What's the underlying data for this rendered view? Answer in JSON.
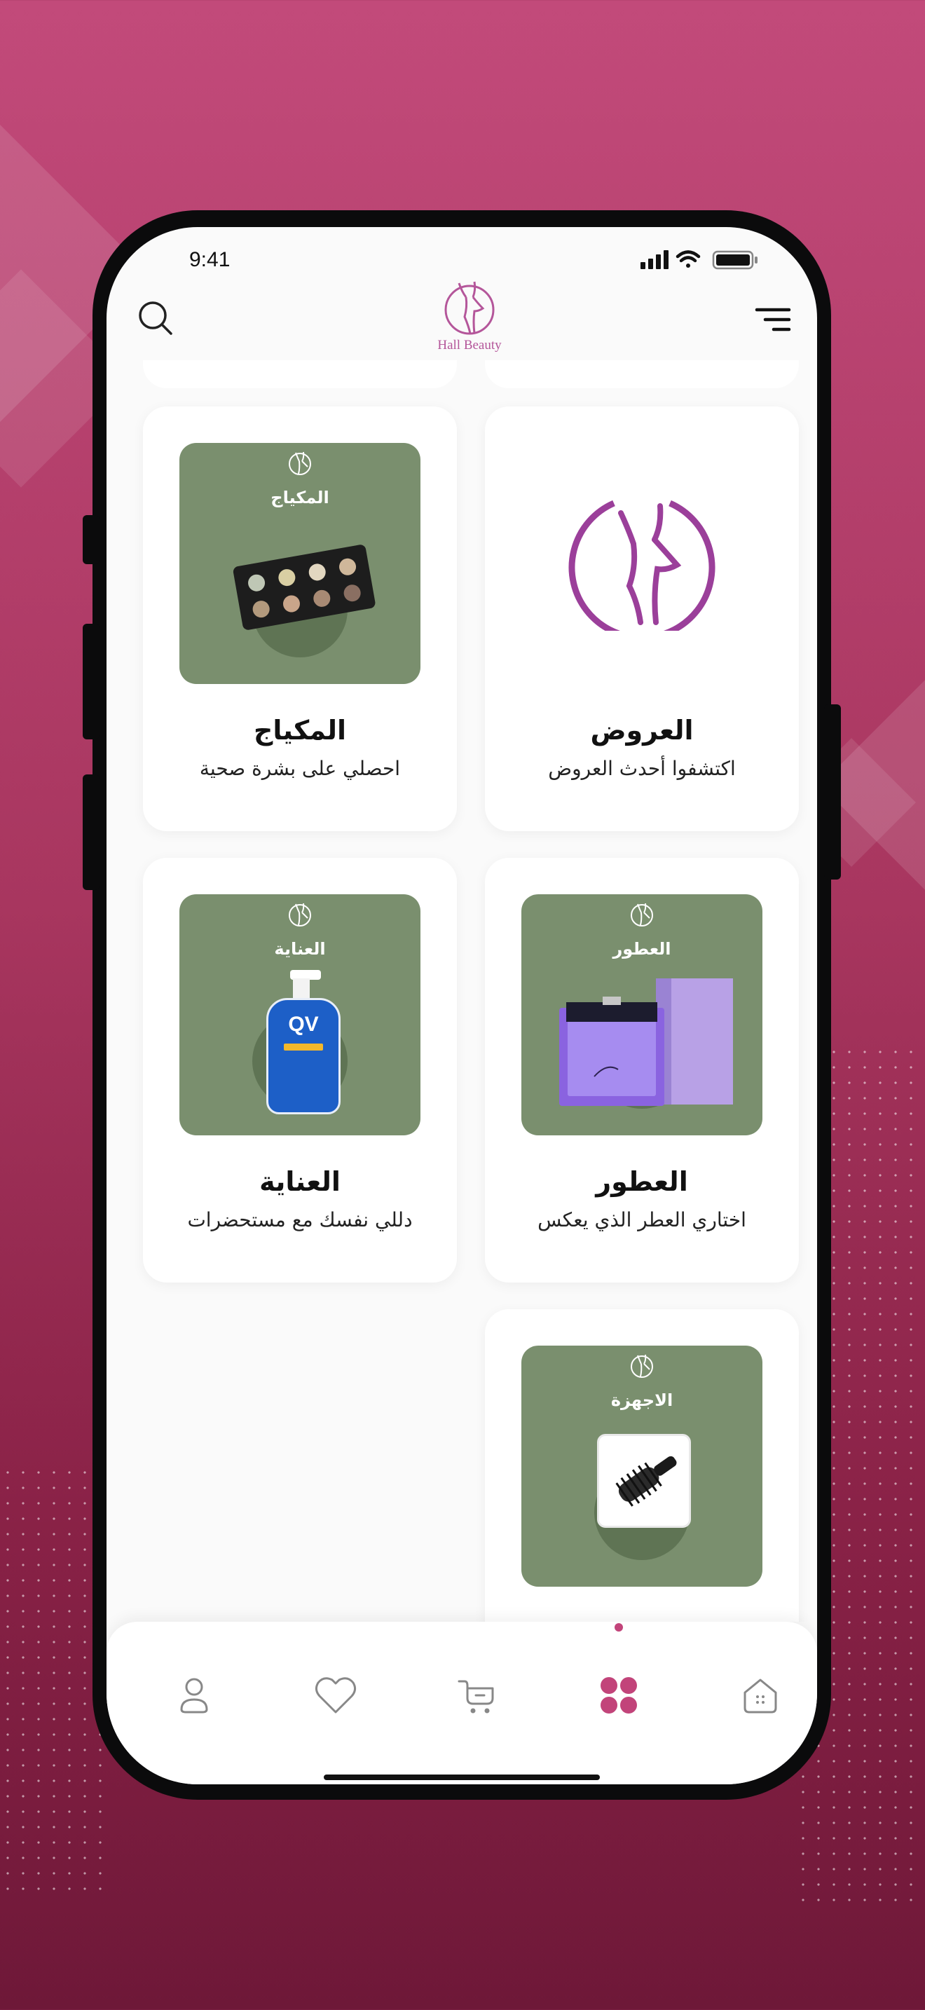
{
  "status_bar": {
    "time": "9:41"
  },
  "header": {
    "brand": "Hall Beauty"
  },
  "categories": [
    {
      "key": "offers",
      "title": "العروض",
      "subtitle": "اكتشفوا أحدث العروض"
    },
    {
      "key": "makeup",
      "title": "المكياج",
      "subtitle": "احصلي على بشرة صحية",
      "image_label": "المكياج"
    },
    {
      "key": "perfumes",
      "title": "العطور",
      "subtitle": "اختاري العطر الذي يعكس",
      "image_label": "العطور"
    },
    {
      "key": "care",
      "title": "العناية",
      "subtitle": "دللي نفسك مع مستحضرات",
      "image_label": "العناية"
    },
    {
      "key": "devices",
      "image_label": "الاجهزة"
    }
  ],
  "product_print": {
    "care": "QV"
  },
  "tabbar": {
    "active": "categories",
    "items": [
      "profile",
      "favorites",
      "cart",
      "categories",
      "home"
    ]
  },
  "colors": {
    "accent": "#c2447a",
    "brand_purple": "#9b3f9a",
    "card_image_bg": "#7a8f6e",
    "background": "#a8365f"
  },
  "icons": {
    "search": "search-icon",
    "menu": "menu-icon",
    "profile": "profile-icon",
    "favorites": "heart-icon",
    "cart": "cart-icon",
    "categories": "grid-icon",
    "home": "home-icon"
  }
}
